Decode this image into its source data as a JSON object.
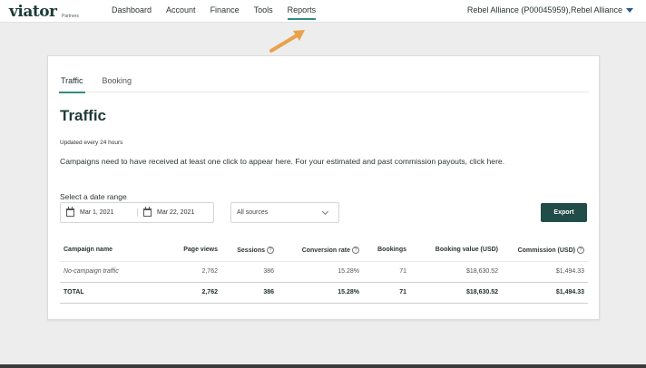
{
  "brand": {
    "logo": "viator",
    "sub": "Partners"
  },
  "nav": [
    {
      "label": "Dashboard"
    },
    {
      "label": "Account"
    },
    {
      "label": "Finance"
    },
    {
      "label": "Tools"
    },
    {
      "label": "Reports"
    }
  ],
  "account": {
    "label": "Rebel Alliance (P00045959),Rebel Alliance"
  },
  "tabs": [
    {
      "label": "Traffic"
    },
    {
      "label": "Booking"
    }
  ],
  "page": {
    "title": "Traffic",
    "updated": "Updated every 24 hours",
    "notice": "Campaigns need to have received at least one click to appear here. For your estimated and past commission payouts, click here."
  },
  "filters": {
    "range_label": "Select a date range",
    "start_date": "Mar 1, 2021",
    "end_date": "Mar 22, 2021",
    "sources": "All sources",
    "export_label": "Export"
  },
  "table": {
    "headers": [
      "Campaign name",
      "Page views",
      "Sessions",
      "Conversion rate",
      "Bookings",
      "Booking value (USD)",
      "Commission (USD)"
    ],
    "rows": [
      [
        "No-campaign traffic",
        "2,762",
        "386",
        "15.28%",
        "71",
        "$18,630.52",
        "$1,494.33"
      ]
    ],
    "total": [
      "TOTAL",
      "2,762",
      "386",
      "15.28%",
      "71",
      "$18,630.52",
      "$1,494.33"
    ]
  },
  "colors": {
    "accent": "#2f8f80",
    "button": "#214d49",
    "arrow": "#e8a24a"
  }
}
